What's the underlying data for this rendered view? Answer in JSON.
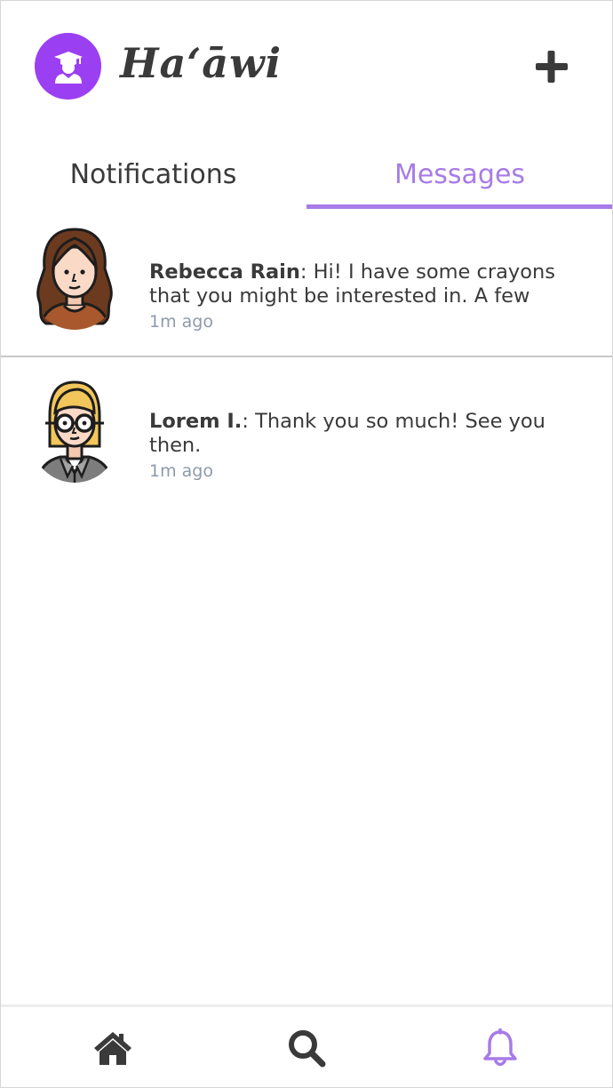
{
  "app": {
    "brand": "Haʻāwi",
    "accent_color": "#a77be8",
    "profile_color": "#9b3ff2"
  },
  "header": {
    "profile_icon": "graduate-user-icon",
    "add_icon": "plus-icon"
  },
  "tabs": [
    {
      "label": "Notifications",
      "active": false
    },
    {
      "label": "Messages",
      "active": true
    }
  ],
  "messages": [
    {
      "avatar": "woman-brown-hair-avatar",
      "sender": "Rebecca Rain",
      "separator": ": ",
      "text": "Hi! I have some crayons that you might be interested in. A few",
      "time": "1m ago"
    },
    {
      "avatar": "woman-glasses-blonde-avatar",
      "sender": "Lorem I.",
      "separator": ": ",
      "text": "Thank you so much! See you then.",
      "time": "1m ago"
    }
  ],
  "bottom_nav": [
    {
      "icon": "home-icon",
      "active": false
    },
    {
      "icon": "search-icon",
      "active": false
    },
    {
      "icon": "bell-icon",
      "active": true
    }
  ]
}
